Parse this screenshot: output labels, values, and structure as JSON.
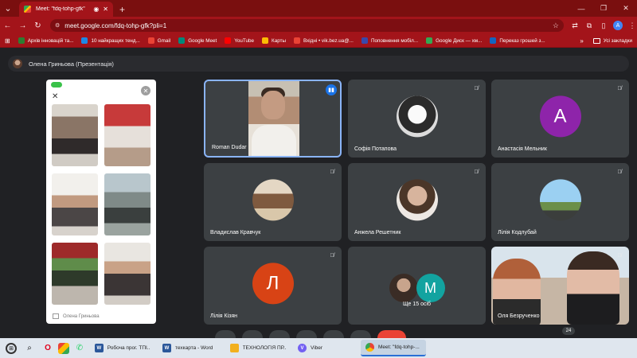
{
  "browser": {
    "tab_title": "Meet: \"fdq-tohp-gfk\"",
    "url": "meet.google.com/fdq-tohp-gfk?pli=1",
    "profile_initial": "A"
  },
  "bookmarks": [
    {
      "label": "Архів інновацій та...",
      "color": "#2e7d32"
    },
    {
      "label": "10 найкращих тенд...",
      "color": "#1e88e5"
    },
    {
      "label": "Gmail",
      "color": "#ea4335"
    },
    {
      "label": "Google Meet",
      "color": "#00897b"
    },
    {
      "label": "YouTube",
      "color": "#ff0000"
    },
    {
      "label": "Карты",
      "color": "#fbbc04"
    },
    {
      "label": "Вхідні • vik.bez.ua@...",
      "color": "#ea4335"
    },
    {
      "label": "Поповнення мобіл...",
      "color": "#3949ab"
    },
    {
      "label": "Google Диск — хм...",
      "color": "#34a853"
    },
    {
      "label": "Переказ грошей з...",
      "color": "#1565c0"
    }
  ],
  "bookmarks_all": "Усі закладки",
  "meet": {
    "presenter_label": "Олена Гриньова (Презентація)",
    "shared_footer_name": "Олена Гриньова",
    "participants": {
      "roman": "Roman Dudar",
      "sofia": "Софія Потапова",
      "anastasia": "Анастасія Мельник",
      "anastasia_initial": "A",
      "vladyslav": "Владислав Кравчук",
      "anzhela": "Анжела Решетник",
      "lilia_k": "Лілія Кодлубай",
      "lilia_kizyan": "Лілія Кізян",
      "lilia_kizyan_initial": "Л",
      "more_label": "Ще 15 осіб",
      "more_initial": "M",
      "olia": "Оля Безрученко"
    },
    "participant_count": "24",
    "colors": {
      "anastasia_avatar": "#8e24aa",
      "lilia_kizyan_avatar": "#d84315",
      "more_avatar": "#12a3a0",
      "accent": "#1a73e8"
    }
  },
  "taskbar": {
    "tasks": [
      {
        "label": "Робоча прог. ТПІ...",
        "icon": "W",
        "color": "#2b579a"
      },
      {
        "label": "техкарта - Word",
        "icon": "W",
        "color": "#2b579a"
      },
      {
        "label": "ТЕХНОЛОГІЯ ПР...",
        "icon": "",
        "color": "#f2b01e"
      },
      {
        "label": "Viber",
        "icon": "V",
        "color": "#7360f2"
      },
      {
        "label": "Meet: \"fdq-tohp-...",
        "icon": "",
        "color": "#4285f4"
      }
    ]
  }
}
